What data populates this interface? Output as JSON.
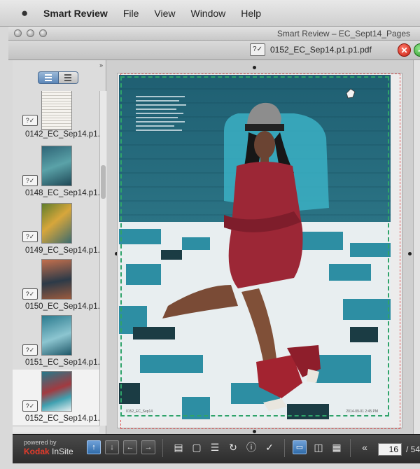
{
  "menubar": {
    "apple": "",
    "items": [
      "Smart Review",
      "File",
      "View",
      "Window",
      "Help"
    ]
  },
  "window": {
    "title": "Smart Review – EC_Sept14_Pages"
  },
  "toolbar": {
    "check_badge": "?✓",
    "file_name": "0152_EC_Sep14.p1.p1.pdf",
    "close_icon": "✕",
    "ok_icon": "✓"
  },
  "sidebar": {
    "collapse": "»",
    "thumbnails": [
      {
        "label": "0142_EC_Sep14.p1.",
        "badge": "?✓",
        "color": "#f1efe9"
      },
      {
        "label": "0148_EC_Sep14.p1.",
        "badge": "?✓",
        "color": "#3f7a8a"
      },
      {
        "label": "0149_EC_Sep14.p1.",
        "badge": "?✓",
        "color": "#6c8a3a"
      },
      {
        "label": "0150_EC_Sep14.p1.",
        "badge": "?✓",
        "color": "#b9674a"
      },
      {
        "label": "0151_EC_Sep14.p1.",
        "badge": "?✓",
        "color": "#2f7e95"
      },
      {
        "label": "0152_EC_Sep14.p1.",
        "badge": "?✓",
        "color": "#2f8fa0",
        "selected": true
      }
    ]
  },
  "page": {
    "folio_left": "0152_EC_Sep14",
    "folio_right": "2014-09-01  2:45 PM"
  },
  "bottombar": {
    "powered_by": "powered by",
    "brand_kodak": "Kodak",
    "brand_insite": " InSite",
    "current_page": "16",
    "total_pages": "/ 54"
  }
}
